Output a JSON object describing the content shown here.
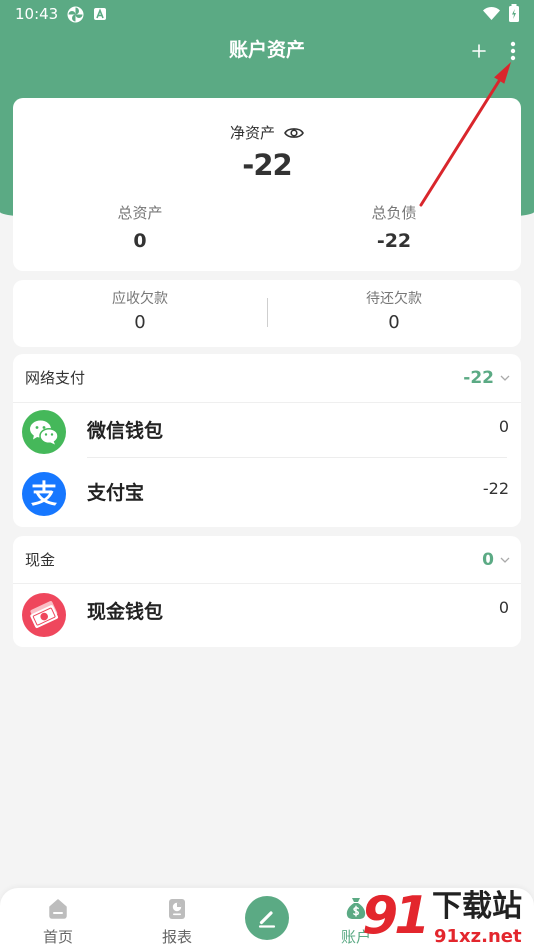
{
  "status_bar": {
    "time": "10:43",
    "left_icons": [
      "pinwheel-icon",
      "a-badge-icon"
    ],
    "right_icons": [
      "wifi-icon",
      "battery-charging-icon"
    ]
  },
  "header": {
    "title": "账户资产",
    "actions": [
      "plus-icon",
      "more-vertical-icon"
    ]
  },
  "summary": {
    "net_assets_label": "净资产",
    "net_assets_value": "-22",
    "visibility_icon": "eye-icon",
    "total_assets_label": "总资产",
    "total_assets_value": "0",
    "total_liabilities_label": "总负债",
    "total_liabilities_value": "-22"
  },
  "debts": {
    "receivable_label": "应收欠款",
    "receivable_value": "0",
    "payable_label": "待还欠款",
    "payable_value": "0"
  },
  "groups": [
    {
      "name": "网络支付",
      "total": "-22",
      "expand_icon": "chevron-down-icon",
      "accounts": [
        {
          "name": "微信钱包",
          "balance": "0",
          "icon": "wechat-icon"
        },
        {
          "name": "支付宝",
          "balance": "-22",
          "icon": "alipay-icon",
          "logo_glyph": "支"
        }
      ]
    },
    {
      "name": "现金",
      "total": "0",
      "expand_icon": "chevron-down-icon",
      "accounts": [
        {
          "name": "现金钱包",
          "balance": "0",
          "icon": "cash-icon"
        }
      ]
    }
  ],
  "bottom_nav": {
    "items": [
      {
        "label": "首页",
        "icon": "home-icon",
        "active": false
      },
      {
        "label": "报表",
        "icon": "report-icon",
        "active": false
      },
      {
        "label": "账户",
        "icon": "money-bag-icon",
        "active": true
      }
    ],
    "center_action_icon": "pencil-icon"
  },
  "watermark": {
    "logo": "91",
    "name": "下载站",
    "url": "91xz.net"
  },
  "annotation": {
    "icon": "red-arrow-icon"
  },
  "colors": {
    "brand_green": "#5BAA84",
    "page_background": "#F4F4F4",
    "wechat_green": "#45B85A",
    "alipay_blue": "#1677FF",
    "cash_red": "#EF475D",
    "annotation_red": "#D9262C",
    "watermark_red": "#E3262D"
  }
}
